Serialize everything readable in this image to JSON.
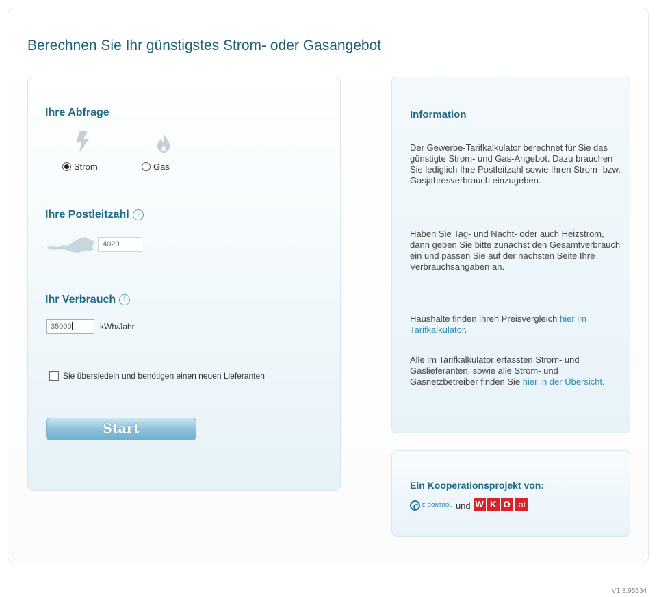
{
  "page": {
    "title": "Berechnen Sie Ihr günstigstes Strom- oder Gasangebot",
    "version": "V1.3.95534"
  },
  "query": {
    "heading": "Ihre Abfrage",
    "options": [
      {
        "label": "Strom",
        "selected": true,
        "icon": "lightning-icon"
      },
      {
        "label": "Gas",
        "selected": false,
        "icon": "flame-icon"
      }
    ]
  },
  "postcode": {
    "heading": "Ihre Postleitzahl",
    "info_icon": "i",
    "value": "4020",
    "map_icon": "austria-map-icon"
  },
  "consumption": {
    "heading": "Ihr Verbrauch",
    "info_icon": "i",
    "value": "35000",
    "unit": "kWh/Jahr"
  },
  "relocation": {
    "label": "Sie übersiedeln und benötigen einen neuen Lieferanten",
    "checked": false
  },
  "start_button": "Start",
  "information": {
    "title": "Information",
    "para1": "Der Gewerbe-Tarifkalkulator berechnet für Sie das günstigte Strom- und Gas-Angebot. Dazu brauchen Sie lediglich Ihre Postleitzahl sowie Ihren Strom- bzw. Gasjahresverbrauch einzugeben.",
    "para2": "Haben Sie Tag- und Nacht- oder auch Heizstrom, dann geben Sie bitte zunächst den Gesamtverbrauch ein und passen Sie auf der nächsten Seite Ihre Verbrauchsangaben an.",
    "para3_text": "Haushalte finden ihren Preisvergleich ",
    "para3_link": "hier im Tarifkalkulator",
    "para3_end": ".",
    "para4_text": "Alle im Tarifkalkulator erfassten Strom- und Gaslieferanten, sowie alle Strom- und Gasnetzbetreiber finden Sie ",
    "para4_link": "hier in der Übersicht",
    "para4_end": "."
  },
  "cooperation": {
    "title": "Ein Kooperationsprojekt von:",
    "econtrol": "E-CONTROL",
    "and": "und",
    "wko_letters": [
      "W",
      "K",
      "O"
    ],
    "wko_suffix": ".at"
  },
  "colors": {
    "heading": "#1e6a86",
    "link": "#2a8cb4",
    "wko_red": "#d8232a",
    "button": "#8ec2da"
  }
}
